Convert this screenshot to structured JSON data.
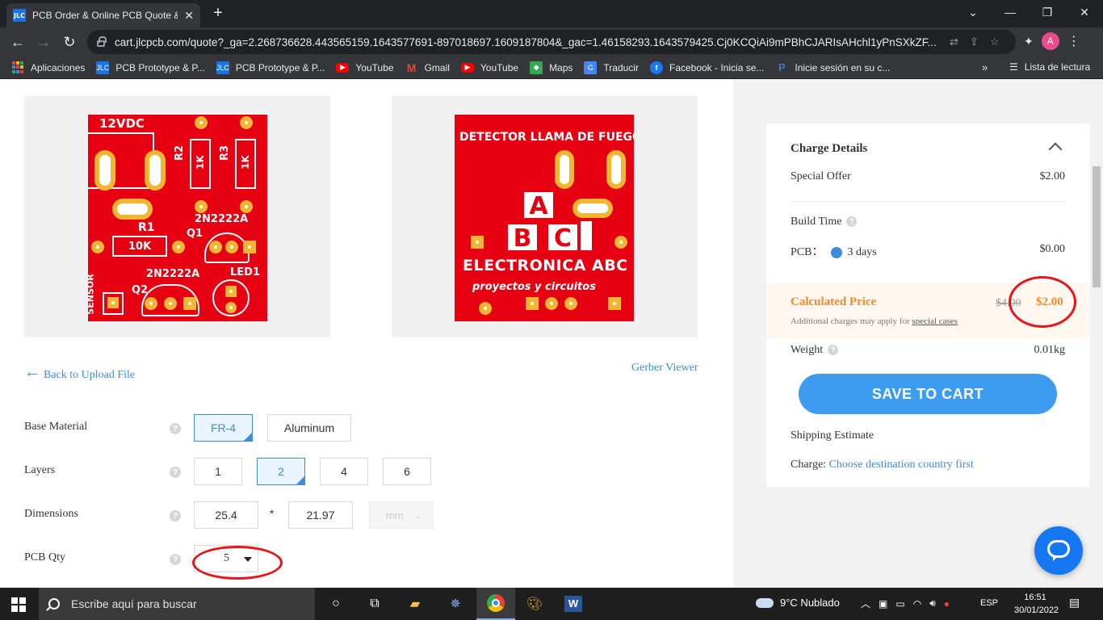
{
  "browser": {
    "tab_title": "PCB Order & Online PCB Quote &",
    "favicon_text": "JLC",
    "url": "cart.jlcpcb.com/quote?_ga=2.268736628.443565159.1643577691-897018697.1609187804&_gac=1.46158293.1643579425.Cj0KCQiAi9mPBhCJARIsAHchl1yPnSXkZF...",
    "profile_initial": "A",
    "bookmarks": [
      {
        "label": "Aplicaciones",
        "icon": "apps-grid-icon",
        "color": "#4285f4"
      },
      {
        "label": "PCB Prototype & P...",
        "icon": "jlc-icon",
        "color": "#1a73e8"
      },
      {
        "label": "PCB Prototype & P...",
        "icon": "jlc-icon",
        "color": "#1a73e8"
      },
      {
        "label": "YouTube",
        "icon": "youtube-icon",
        "color": "#ff0000"
      },
      {
        "label": "Gmail",
        "icon": "gmail-icon",
        "color": "#ea4335"
      },
      {
        "label": "YouTube",
        "icon": "youtube-icon",
        "color": "#ff0000"
      },
      {
        "label": "Maps",
        "icon": "maps-icon",
        "color": "#34a853"
      },
      {
        "label": "Traducir",
        "icon": "translate-icon",
        "color": "#4285f4"
      },
      {
        "label": "Facebook - Inicia se...",
        "icon": "facebook-icon",
        "color": "#1877f2"
      },
      {
        "label": "Inicie sesión en su c...",
        "icon": "paypal-icon",
        "color": "#003087"
      }
    ],
    "bookmark_overflow": "»",
    "reading_list": "Lista de lectura"
  },
  "pcb_preview": {
    "left_board": {
      "texts": [
        "12VDC",
        "R2",
        "1K",
        "R3",
        "1K",
        "R1",
        "10K",
        "2N2222A",
        "Q1",
        "2N2222A",
        "LED1",
        "Q2",
        "SENSOR"
      ]
    },
    "right_board": {
      "texts": [
        "DETECTOR LLAMA DE FUEGO",
        "A",
        "B",
        "C",
        "ELECTRONICA ABC",
        "proyectos y circuitos"
      ]
    }
  },
  "links": {
    "back": "Back to Upload File",
    "gerber": "Gerber Viewer"
  },
  "options": {
    "base_material": {
      "label": "Base Material",
      "choices": [
        "FR-4",
        "Aluminum"
      ],
      "selected": "FR-4"
    },
    "layers": {
      "label": "Layers",
      "choices": [
        "1",
        "2",
        "4",
        "6"
      ],
      "selected": "2"
    },
    "dimensions": {
      "label": "Dimensions",
      "x": "25.4",
      "separator": "*",
      "y": "21.97",
      "unit": "mm"
    },
    "pcb_qty": {
      "label": "PCB Qty",
      "value": "5"
    }
  },
  "charge": {
    "title": "Charge Details",
    "special_offer": {
      "label": "Special Offer",
      "value": "$2.00"
    },
    "build_time": {
      "label": "Build Time"
    },
    "pcb": {
      "label": "PCB：",
      "option": "3 days",
      "value": "$0.00"
    },
    "calculated": {
      "label": "Calculated Price",
      "old": "$4.00",
      "new": "$2.00",
      "note": "Additional charges may apply for",
      "note_link": "special cases"
    },
    "weight": {
      "label": "Weight",
      "value": "0.01kg"
    },
    "save_button": "SAVE TO CART",
    "shipping": "Shipping Estimate",
    "charge_label": "Charge:",
    "charge_link": "Choose destination country first"
  },
  "taskbar": {
    "search_placeholder": "Escribe aquí para buscar",
    "weather": "9°C  Nublado",
    "lang": "ESP",
    "time": "16:51",
    "date": "30/01/2022"
  },
  "colors": {
    "accent": "#3d8bd9",
    "price_orange": "#f08a2c",
    "annotation_red": "#e8141a",
    "pcb_red": "#e60012"
  }
}
